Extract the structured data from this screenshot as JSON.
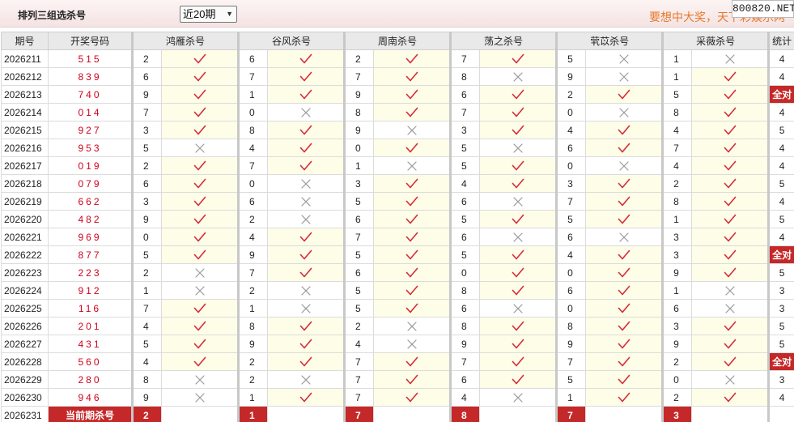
{
  "header": {
    "title": "排列三组选杀号",
    "select_value": "近20期",
    "slogan": "要想中大奖，天下彩娱乐网",
    "watermark": "800820.NET"
  },
  "table": {
    "col_period": "期号",
    "col_draw": "开奖号码",
    "experts": [
      "鸿雁杀号",
      "谷风杀号",
      "周南杀号",
      "荡之杀号",
      "茕苡杀号",
      "采薇杀号"
    ],
    "col_count": "统计",
    "full_label": "全对",
    "rows": [
      {
        "period": "2026211",
        "draw": "515",
        "picks": [
          [
            "2",
            "y"
          ],
          [
            "6",
            "y"
          ],
          [
            "2",
            "y"
          ],
          [
            "7",
            "y"
          ],
          [
            "5",
            "n"
          ],
          [
            "1",
            "n"
          ]
        ],
        "count": "4"
      },
      {
        "period": "2026212",
        "draw": "839",
        "picks": [
          [
            "6",
            "y"
          ],
          [
            "7",
            "y"
          ],
          [
            "7",
            "y"
          ],
          [
            "8",
            "n"
          ],
          [
            "9",
            "n"
          ],
          [
            "1",
            "y"
          ]
        ],
        "count": "4"
      },
      {
        "period": "2026213",
        "draw": "740",
        "picks": [
          [
            "9",
            "y"
          ],
          [
            "1",
            "y"
          ],
          [
            "9",
            "y"
          ],
          [
            "6",
            "y"
          ],
          [
            "2",
            "y"
          ],
          [
            "5",
            "y"
          ]
        ],
        "count": "全对"
      },
      {
        "period": "2026214",
        "draw": "014",
        "picks": [
          [
            "7",
            "y"
          ],
          [
            "0",
            "n"
          ],
          [
            "8",
            "y"
          ],
          [
            "7",
            "y"
          ],
          [
            "0",
            "n"
          ],
          [
            "8",
            "y"
          ]
        ],
        "count": "4"
      },
      {
        "period": "2026215",
        "draw": "927",
        "picks": [
          [
            "3",
            "y"
          ],
          [
            "8",
            "y"
          ],
          [
            "9",
            "n"
          ],
          [
            "3",
            "y"
          ],
          [
            "4",
            "y"
          ],
          [
            "4",
            "y"
          ]
        ],
        "count": "5"
      },
      {
        "period": "2026216",
        "draw": "953",
        "picks": [
          [
            "5",
            "n"
          ],
          [
            "4",
            "y"
          ],
          [
            "0",
            "y"
          ],
          [
            "5",
            "n"
          ],
          [
            "6",
            "y"
          ],
          [
            "7",
            "y"
          ]
        ],
        "count": "4"
      },
      {
        "period": "2026217",
        "draw": "019",
        "picks": [
          [
            "2",
            "y"
          ],
          [
            "7",
            "y"
          ],
          [
            "1",
            "n"
          ],
          [
            "5",
            "y"
          ],
          [
            "0",
            "n"
          ],
          [
            "4",
            "y"
          ]
        ],
        "count": "4"
      },
      {
        "period": "2026218",
        "draw": "079",
        "picks": [
          [
            "6",
            "y"
          ],
          [
            "0",
            "n"
          ],
          [
            "3",
            "y"
          ],
          [
            "4",
            "y"
          ],
          [
            "3",
            "y"
          ],
          [
            "2",
            "y"
          ]
        ],
        "count": "5"
      },
      {
        "period": "2026219",
        "draw": "662",
        "picks": [
          [
            "3",
            "y"
          ],
          [
            "6",
            "n"
          ],
          [
            "5",
            "y"
          ],
          [
            "6",
            "n"
          ],
          [
            "7",
            "y"
          ],
          [
            "8",
            "y"
          ]
        ],
        "count": "4"
      },
      {
        "period": "2026220",
        "draw": "482",
        "picks": [
          [
            "9",
            "y"
          ],
          [
            "2",
            "n"
          ],
          [
            "6",
            "y"
          ],
          [
            "5",
            "y"
          ],
          [
            "5",
            "y"
          ],
          [
            "1",
            "y"
          ]
        ],
        "count": "5"
      },
      {
        "period": "2026221",
        "draw": "969",
        "picks": [
          [
            "0",
            "y"
          ],
          [
            "4",
            "y"
          ],
          [
            "7",
            "y"
          ],
          [
            "6",
            "n"
          ],
          [
            "6",
            "n"
          ],
          [
            "3",
            "y"
          ]
        ],
        "count": "4"
      },
      {
        "period": "2026222",
        "draw": "877",
        "picks": [
          [
            "5",
            "y"
          ],
          [
            "9",
            "y"
          ],
          [
            "5",
            "y"
          ],
          [
            "5",
            "y"
          ],
          [
            "4",
            "y"
          ],
          [
            "3",
            "y"
          ]
        ],
        "count": "全对"
      },
      {
        "period": "2026223",
        "draw": "223",
        "picks": [
          [
            "2",
            "n"
          ],
          [
            "7",
            "y"
          ],
          [
            "6",
            "y"
          ],
          [
            "0",
            "y"
          ],
          [
            "0",
            "y"
          ],
          [
            "9",
            "y"
          ]
        ],
        "count": "5"
      },
      {
        "period": "2026224",
        "draw": "912",
        "picks": [
          [
            "1",
            "n"
          ],
          [
            "2",
            "n"
          ],
          [
            "5",
            "y"
          ],
          [
            "8",
            "y"
          ],
          [
            "6",
            "y"
          ],
          [
            "1",
            "n"
          ]
        ],
        "count": "3"
      },
      {
        "period": "2026225",
        "draw": "116",
        "picks": [
          [
            "7",
            "y"
          ],
          [
            "1",
            "n"
          ],
          [
            "5",
            "y"
          ],
          [
            "6",
            "n"
          ],
          [
            "0",
            "y"
          ],
          [
            "6",
            "n"
          ]
        ],
        "count": "3"
      },
      {
        "period": "2026226",
        "draw": "201",
        "picks": [
          [
            "4",
            "y"
          ],
          [
            "8",
            "y"
          ],
          [
            "2",
            "n"
          ],
          [
            "8",
            "y"
          ],
          [
            "8",
            "y"
          ],
          [
            "3",
            "y"
          ]
        ],
        "count": "5"
      },
      {
        "period": "2026227",
        "draw": "431",
        "picks": [
          [
            "5",
            "y"
          ],
          [
            "9",
            "y"
          ],
          [
            "4",
            "n"
          ],
          [
            "9",
            "y"
          ],
          [
            "9",
            "y"
          ],
          [
            "9",
            "y"
          ]
        ],
        "count": "5"
      },
      {
        "period": "2026228",
        "draw": "560",
        "picks": [
          [
            "4",
            "y"
          ],
          [
            "2",
            "y"
          ],
          [
            "7",
            "y"
          ],
          [
            "7",
            "y"
          ],
          [
            "7",
            "y"
          ],
          [
            "2",
            "y"
          ]
        ],
        "count": "全对"
      },
      {
        "period": "2026229",
        "draw": "280",
        "picks": [
          [
            "8",
            "n"
          ],
          [
            "2",
            "n"
          ],
          [
            "7",
            "y"
          ],
          [
            "6",
            "y"
          ],
          [
            "5",
            "y"
          ],
          [
            "0",
            "n"
          ]
        ],
        "count": "3"
      },
      {
        "period": "2026230",
        "draw": "946",
        "picks": [
          [
            "9",
            "n"
          ],
          [
            "1",
            "y"
          ],
          [
            "7",
            "y"
          ],
          [
            "4",
            "n"
          ],
          [
            "1",
            "y"
          ],
          [
            "2",
            "y"
          ]
        ],
        "count": "4"
      }
    ],
    "current": {
      "period": "2026231",
      "label": "当前期杀号",
      "picks": [
        "2",
        "1",
        "7",
        "8",
        "7",
        "3"
      ]
    }
  },
  "colors": {
    "check": "#d62b3a",
    "cross": "#9a9a9a",
    "accent_red": "#c52828",
    "draw_red": "#d0021b",
    "slogan_orange": "#e8782a"
  },
  "icons": {
    "correct": "check-icon",
    "wrong": "cross-icon",
    "dropdown": "chevron-down-icon"
  }
}
